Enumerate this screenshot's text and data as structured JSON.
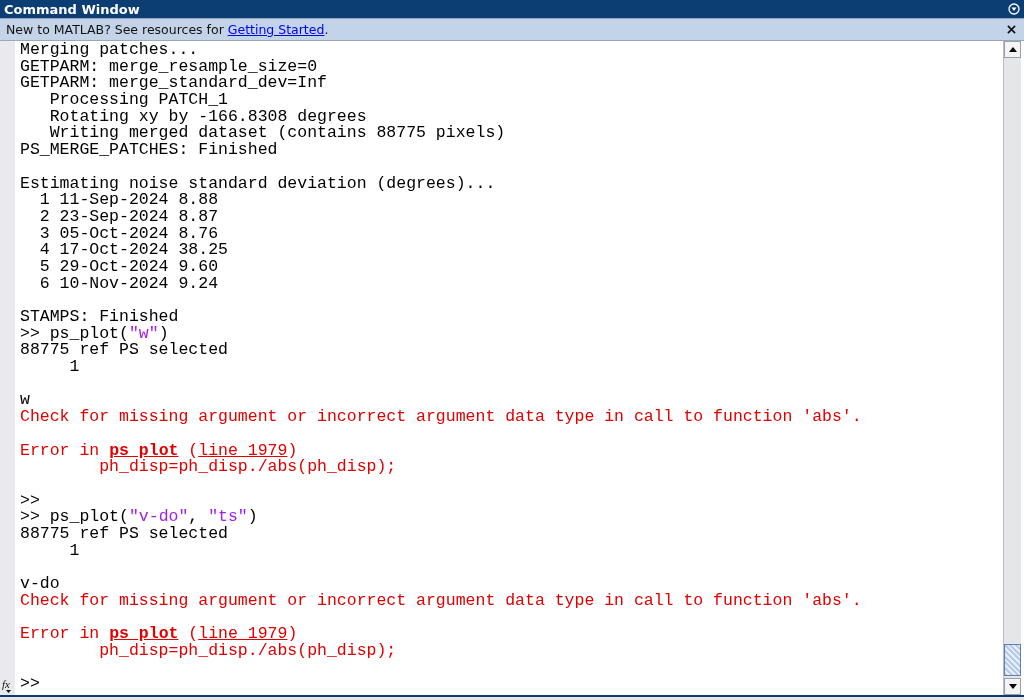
{
  "window": {
    "title": "Command Window"
  },
  "info_bar": {
    "text": "New to MATLAB? See resources for ",
    "link": "Getting Started",
    "after": "."
  },
  "lines": [
    {
      "kind": "output",
      "parts": [
        {
          "kind": "plain",
          "text": "Merging patches..."
        }
      ]
    },
    {
      "kind": "output",
      "parts": [
        {
          "kind": "plain",
          "text": "GETPARM: merge_resample_size=0"
        }
      ]
    },
    {
      "kind": "output",
      "parts": [
        {
          "kind": "plain",
          "text": "GETPARM: merge_standard_dev=Inf"
        }
      ]
    },
    {
      "kind": "output",
      "parts": [
        {
          "kind": "plain",
          "text": "   Processing PATCH_1"
        }
      ]
    },
    {
      "kind": "output",
      "parts": [
        {
          "kind": "plain",
          "text": "   Rotating xy by -166.8308 degrees"
        }
      ]
    },
    {
      "kind": "output",
      "parts": [
        {
          "kind": "plain",
          "text": "   Writing merged dataset (contains 88775 pixels)"
        }
      ]
    },
    {
      "kind": "output",
      "parts": [
        {
          "kind": "plain",
          "text": "PS_MERGE_PATCHES: Finished"
        }
      ]
    },
    {
      "kind": "blank"
    },
    {
      "kind": "output",
      "parts": [
        {
          "kind": "plain",
          "text": "Estimating noise standard deviation (degrees)..."
        }
      ]
    },
    {
      "kind": "output",
      "parts": [
        {
          "kind": "plain",
          "text": "  1 11-Sep-2024 8.88"
        }
      ]
    },
    {
      "kind": "output",
      "parts": [
        {
          "kind": "plain",
          "text": "  2 23-Sep-2024 8.87"
        }
      ]
    },
    {
      "kind": "output",
      "parts": [
        {
          "kind": "plain",
          "text": "  3 05-Oct-2024 8.76"
        }
      ]
    },
    {
      "kind": "output",
      "parts": [
        {
          "kind": "plain",
          "text": "  4 17-Oct-2024 38.25"
        }
      ]
    },
    {
      "kind": "output",
      "parts": [
        {
          "kind": "plain",
          "text": "  5 29-Oct-2024 9.60"
        }
      ]
    },
    {
      "kind": "output",
      "parts": [
        {
          "kind": "plain",
          "text": "  6 10-Nov-2024 9.24"
        }
      ]
    },
    {
      "kind": "blank"
    },
    {
      "kind": "output",
      "parts": [
        {
          "kind": "plain",
          "text": "STAMPS: Finished"
        }
      ]
    },
    {
      "kind": "command",
      "parts": [
        {
          "kind": "plain",
          "text": ">> ps_plot("
        },
        {
          "kind": "string",
          "text": "\"w\""
        },
        {
          "kind": "plain",
          "text": ")"
        }
      ]
    },
    {
      "kind": "output",
      "parts": [
        {
          "kind": "plain",
          "text": "88775 ref PS selected"
        }
      ]
    },
    {
      "kind": "output",
      "parts": [
        {
          "kind": "plain",
          "text": "     1"
        }
      ]
    },
    {
      "kind": "blank"
    },
    {
      "kind": "output",
      "parts": [
        {
          "kind": "plain",
          "text": "w"
        }
      ]
    },
    {
      "kind": "error",
      "parts": [
        {
          "kind": "error",
          "text": "Check for missing argument or incorrect argument data type in call to function 'abs'."
        }
      ]
    },
    {
      "kind": "blank"
    },
    {
      "kind": "error",
      "parts": [
        {
          "kind": "error",
          "text": "Error in "
        },
        {
          "kind": "error_link",
          "text": "ps plot"
        },
        {
          "kind": "error",
          "text": " ("
        },
        {
          "kind": "link",
          "text": "line 1979"
        },
        {
          "kind": "error",
          "text": ")"
        }
      ]
    },
    {
      "kind": "error",
      "parts": [
        {
          "kind": "error",
          "text": "        ph_disp=ph_disp./abs(ph_disp);"
        }
      ]
    },
    {
      "kind": "blank"
    },
    {
      "kind": "command",
      "parts": [
        {
          "kind": "plain",
          "text": ">>"
        }
      ]
    },
    {
      "kind": "command",
      "parts": [
        {
          "kind": "plain",
          "text": ">> ps_plot("
        },
        {
          "kind": "string",
          "text": "\"v-do\""
        },
        {
          "kind": "plain",
          "text": ", "
        },
        {
          "kind": "string",
          "text": "\"ts\""
        },
        {
          "kind": "plain",
          "text": ")"
        }
      ]
    },
    {
      "kind": "output",
      "parts": [
        {
          "kind": "plain",
          "text": "88775 ref PS selected"
        }
      ]
    },
    {
      "kind": "output",
      "parts": [
        {
          "kind": "plain",
          "text": "     1"
        }
      ]
    },
    {
      "kind": "blank"
    },
    {
      "kind": "output",
      "parts": [
        {
          "kind": "plain",
          "text": "v-do"
        }
      ]
    },
    {
      "kind": "error",
      "parts": [
        {
          "kind": "error",
          "text": "Check for missing argument or incorrect argument data type in call to function 'abs'."
        }
      ]
    },
    {
      "kind": "blank"
    },
    {
      "kind": "error",
      "parts": [
        {
          "kind": "error",
          "text": "Error in "
        },
        {
          "kind": "error_link",
          "text": "ps plot"
        },
        {
          "kind": "error",
          "text": " ("
        },
        {
          "kind": "link",
          "text": "line 1979"
        },
        {
          "kind": "error",
          "text": ")"
        }
      ]
    },
    {
      "kind": "error",
      "parts": [
        {
          "kind": "error",
          "text": "        ph_disp=ph_disp./abs(ph_disp);"
        }
      ]
    },
    {
      "kind": "blank"
    }
  ],
  "prompt": ">>",
  "function_button": "fx"
}
